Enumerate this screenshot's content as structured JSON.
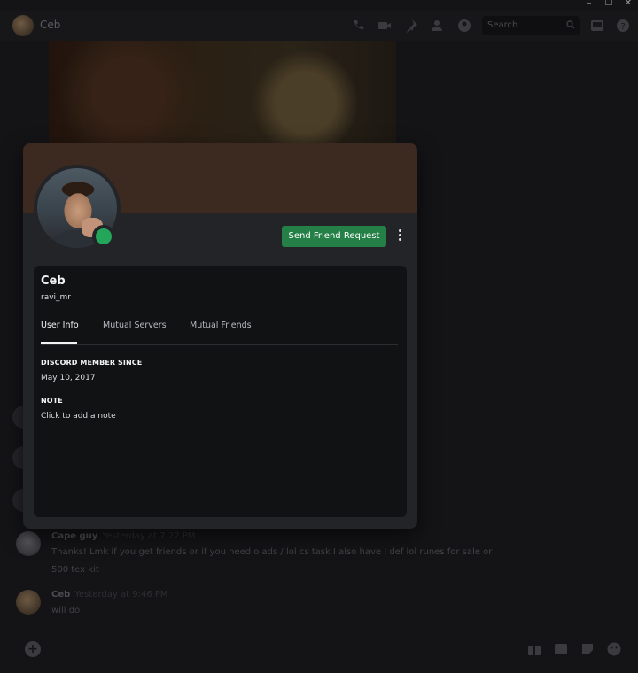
{
  "window": {
    "controls": [
      "–",
      "☐",
      "✕"
    ]
  },
  "header": {
    "title": "Ceb",
    "search_placeholder": "Search",
    "icons": [
      "phone-icon",
      "video-icon",
      "pin-icon",
      "add-friend-icon",
      "profile-icon",
      "inbox-icon",
      "help-icon"
    ]
  },
  "chat": {
    "messages": [
      {
        "author": "Cape guy",
        "time": "Yesterday at 7:22 PM",
        "text": "Thanks! Lmk if you get friends or if you need o ads / lol cs task I also have I def lol runes for sale or 500 tex kit"
      },
      {
        "author": "Ceb",
        "time": "Yesterday at 9:46 PM",
        "text": "will do"
      }
    ]
  },
  "composer": {
    "plus_label": "+",
    "icons": [
      "gift-icon",
      "gif-icon",
      "sticker-icon",
      "emoji-icon"
    ]
  },
  "profile": {
    "display_name": "Ceb",
    "username": "ravi_mr",
    "status": "online",
    "status_color": "#23a55a",
    "banner_color": "#3c2a20",
    "send_friend_request_label": "Send Friend Request",
    "tabs": [
      {
        "label": "User Info",
        "active": true
      },
      {
        "label": "Mutual Servers",
        "active": false
      },
      {
        "label": "Mutual Friends",
        "active": false
      }
    ],
    "member_since_heading": "DISCORD MEMBER SINCE",
    "member_since_value": "May 10, 2017",
    "note_heading": "NOTE",
    "note_placeholder": "Click to add a note"
  },
  "colors": {
    "accent_green": "#248046",
    "background": "#141417",
    "panel": "#232428",
    "inner_panel": "#111214"
  }
}
